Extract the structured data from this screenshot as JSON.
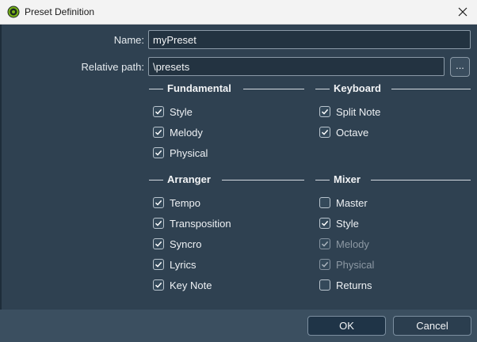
{
  "window": {
    "title": "Preset Definition",
    "close_glyph": "✕"
  },
  "form": {
    "name_label": "Name:",
    "name_value": "myPreset",
    "path_label": "Relative path:",
    "path_value": "\\presets",
    "browse_label": "..."
  },
  "groups": {
    "fundamental": {
      "title": "Fundamental",
      "items": [
        {
          "label": "Style",
          "checked": true,
          "enabled": true
        },
        {
          "label": "Melody",
          "checked": true,
          "enabled": true
        },
        {
          "label": "Physical",
          "checked": true,
          "enabled": true
        }
      ]
    },
    "keyboard": {
      "title": "Keyboard",
      "items": [
        {
          "label": "Split Note",
          "checked": true,
          "enabled": true
        },
        {
          "label": "Octave",
          "checked": true,
          "enabled": true
        }
      ]
    },
    "arranger": {
      "title": "Arranger",
      "items": [
        {
          "label": "Tempo",
          "checked": true,
          "enabled": true
        },
        {
          "label": "Transposition",
          "checked": true,
          "enabled": true
        },
        {
          "label": "Syncro",
          "checked": true,
          "enabled": true
        },
        {
          "label": "Lyrics",
          "checked": true,
          "enabled": true
        },
        {
          "label": "Key Note",
          "checked": true,
          "enabled": true
        }
      ]
    },
    "mixer": {
      "title": "Mixer",
      "items": [
        {
          "label": "Master",
          "checked": false,
          "enabled": true
        },
        {
          "label": "Style",
          "checked": true,
          "enabled": true
        },
        {
          "label": "Melody",
          "checked": true,
          "enabled": false
        },
        {
          "label": "Physical",
          "checked": true,
          "enabled": false
        },
        {
          "label": "Returns",
          "checked": false,
          "enabled": true
        }
      ]
    }
  },
  "footer": {
    "ok_label": "OK",
    "cancel_label": "Cancel"
  },
  "colors": {
    "background": "#2f4151",
    "footer": "#3b4f60",
    "accent_icon": "#7ab317"
  }
}
